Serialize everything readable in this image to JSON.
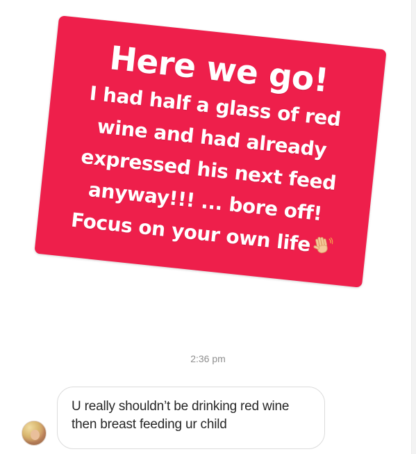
{
  "story": {
    "title": "Here we go!",
    "lines": [
      "I had half a glass of red",
      "wine and had already",
      "expressed his next feed",
      "anyway!!! ... bore off!",
      "Focus on your own life"
    ],
    "emoji": "waving-hand-icon",
    "background_color": "#ee1f4b",
    "text_color": "#ffffff"
  },
  "timestamp": "2:36 pm",
  "message": {
    "text": "U really shouldn’t be drinking red wine then breast feeding ur child",
    "bubble_border_color": "#dbdbdb",
    "text_color": "#262626"
  },
  "sender": {
    "avatar": "avatar-photo"
  }
}
